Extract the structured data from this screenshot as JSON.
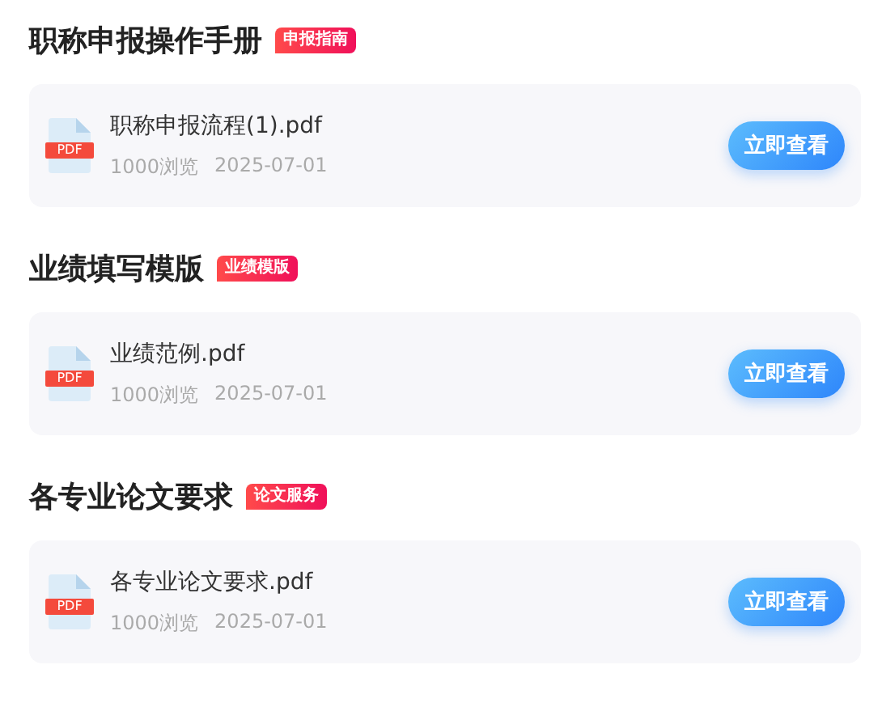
{
  "sections": [
    {
      "title": "职称申报操作手册",
      "tag": "申报指南",
      "files": [
        {
          "icon_label": "PDF",
          "name": "职称申报流程(1).pdf",
          "views": "1000浏览",
          "date": "2025-07-01",
          "button": "立即查看"
        }
      ]
    },
    {
      "title": "业绩填写模版",
      "tag": "业绩模版",
      "files": [
        {
          "icon_label": "PDF",
          "name": "业绩范例.pdf",
          "views": "1000浏览",
          "date": "2025-07-01",
          "button": "立即查看"
        }
      ]
    },
    {
      "title": "各专业论文要求",
      "tag": "论文服务",
      "files": [
        {
          "icon_label": "PDF",
          "name": "各专业论文要求.pdf",
          "views": "1000浏览",
          "date": "2025-07-01",
          "button": "立即查看"
        }
      ]
    }
  ]
}
